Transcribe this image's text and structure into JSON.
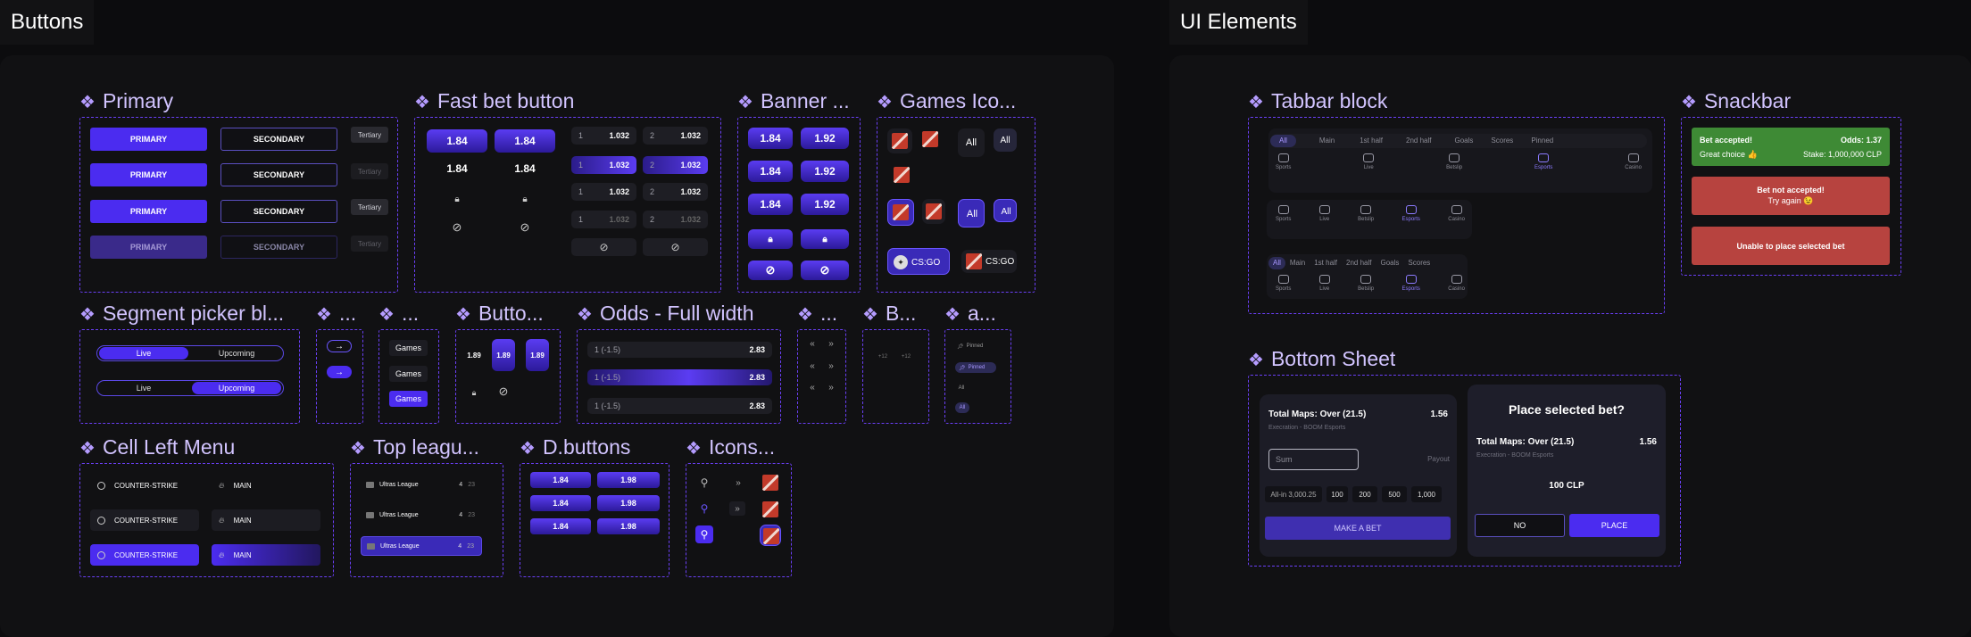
{
  "frames": {
    "buttons": "Buttons",
    "ui_elements": "UI Elements"
  },
  "colors": {
    "accent": "#4b2cf0",
    "success": "#3e8a35",
    "error": "#b7433f",
    "dashed": "#6a3ff5",
    "title": "#d2c4ff"
  },
  "sections": {
    "primary": "Primary",
    "fast_bet": "Fast bet button",
    "banner": "Banner ...",
    "games_icon": "Games Ico...",
    "segment": "Segment picker bl...",
    "s1": "...",
    "s2": "...",
    "butto": "Butto...",
    "odds_full": "Odds - Full width",
    "s3": "...",
    "b": "B...",
    "a": "a...",
    "cell_left": "Cell Left Menu",
    "top_league": "Top leagu...",
    "d_buttons": "D.buttons",
    "icons": "Icons...",
    "tabbar": "Tabbar block",
    "snackbar": "Snackbar",
    "bottom_sheet": "Bottom Sheet"
  },
  "primary": {
    "primary": "PRIMARY",
    "secondary": "SECONDARY",
    "tertiary": "Tertiary"
  },
  "fast_bet": {
    "odd": "1.84",
    "n1": "1",
    "n2": "2",
    "v": "1.032"
  },
  "banner": {
    "a": "1.84",
    "b": "1.92"
  },
  "games": {
    "all": "All",
    "csgo": "CS:GO"
  },
  "segment": {
    "live": "Live",
    "upcoming": "Upcoming"
  },
  "games_list": {
    "games": "Games"
  },
  "butto": {
    "v": "1.89"
  },
  "odds_full": {
    "label": "1 (-1.5)",
    "value": "2.83"
  },
  "b": {
    "t": "+12"
  },
  "a": {
    "pinned": "Pinned",
    "all": "All"
  },
  "cell_left": {
    "cs": "COUNTER-STRIKE",
    "main": "MAIN"
  },
  "top_league": {
    "name": "Ultras League",
    "n": "4",
    "m": "23"
  },
  "d_buttons": {
    "a": "1.84",
    "b": "1.98"
  },
  "tabbar": {
    "tabs": [
      "All",
      "Main",
      "1st half",
      "2nd half",
      "Goals",
      "Scores",
      "Pinned"
    ],
    "tabs2": [
      "All",
      "Main",
      "1st half",
      "2nd half",
      "Goals",
      "Scores"
    ],
    "icons": [
      "Sports",
      "Live",
      "Betslip",
      "Esports",
      "Casino"
    ]
  },
  "snackbar": {
    "accepted": "Bet accepted!",
    "odds": "Odds: 1.37",
    "great": "Great choice 👍",
    "stake": "Stake: 1,000,000 CLP",
    "not_accepted": "Bet not accepted!",
    "try_again": "Try again 😉",
    "unable": "Unable to place selected bet"
  },
  "bottom_sheet": {
    "market": "Total Maps: Over (21.5)",
    "odd": "1.56",
    "event": "Execration - BOOM Esports",
    "sum": "Sum",
    "payout": "Payout",
    "allin": "All-in 3,000.25",
    "q1": "100",
    "q2": "200",
    "q3": "500",
    "q4": "1,000",
    "make_bet": "MAKE A BET",
    "title": "Place selected bet?",
    "amount": "100 CLP",
    "no": "NO",
    "place": "PLACE"
  }
}
